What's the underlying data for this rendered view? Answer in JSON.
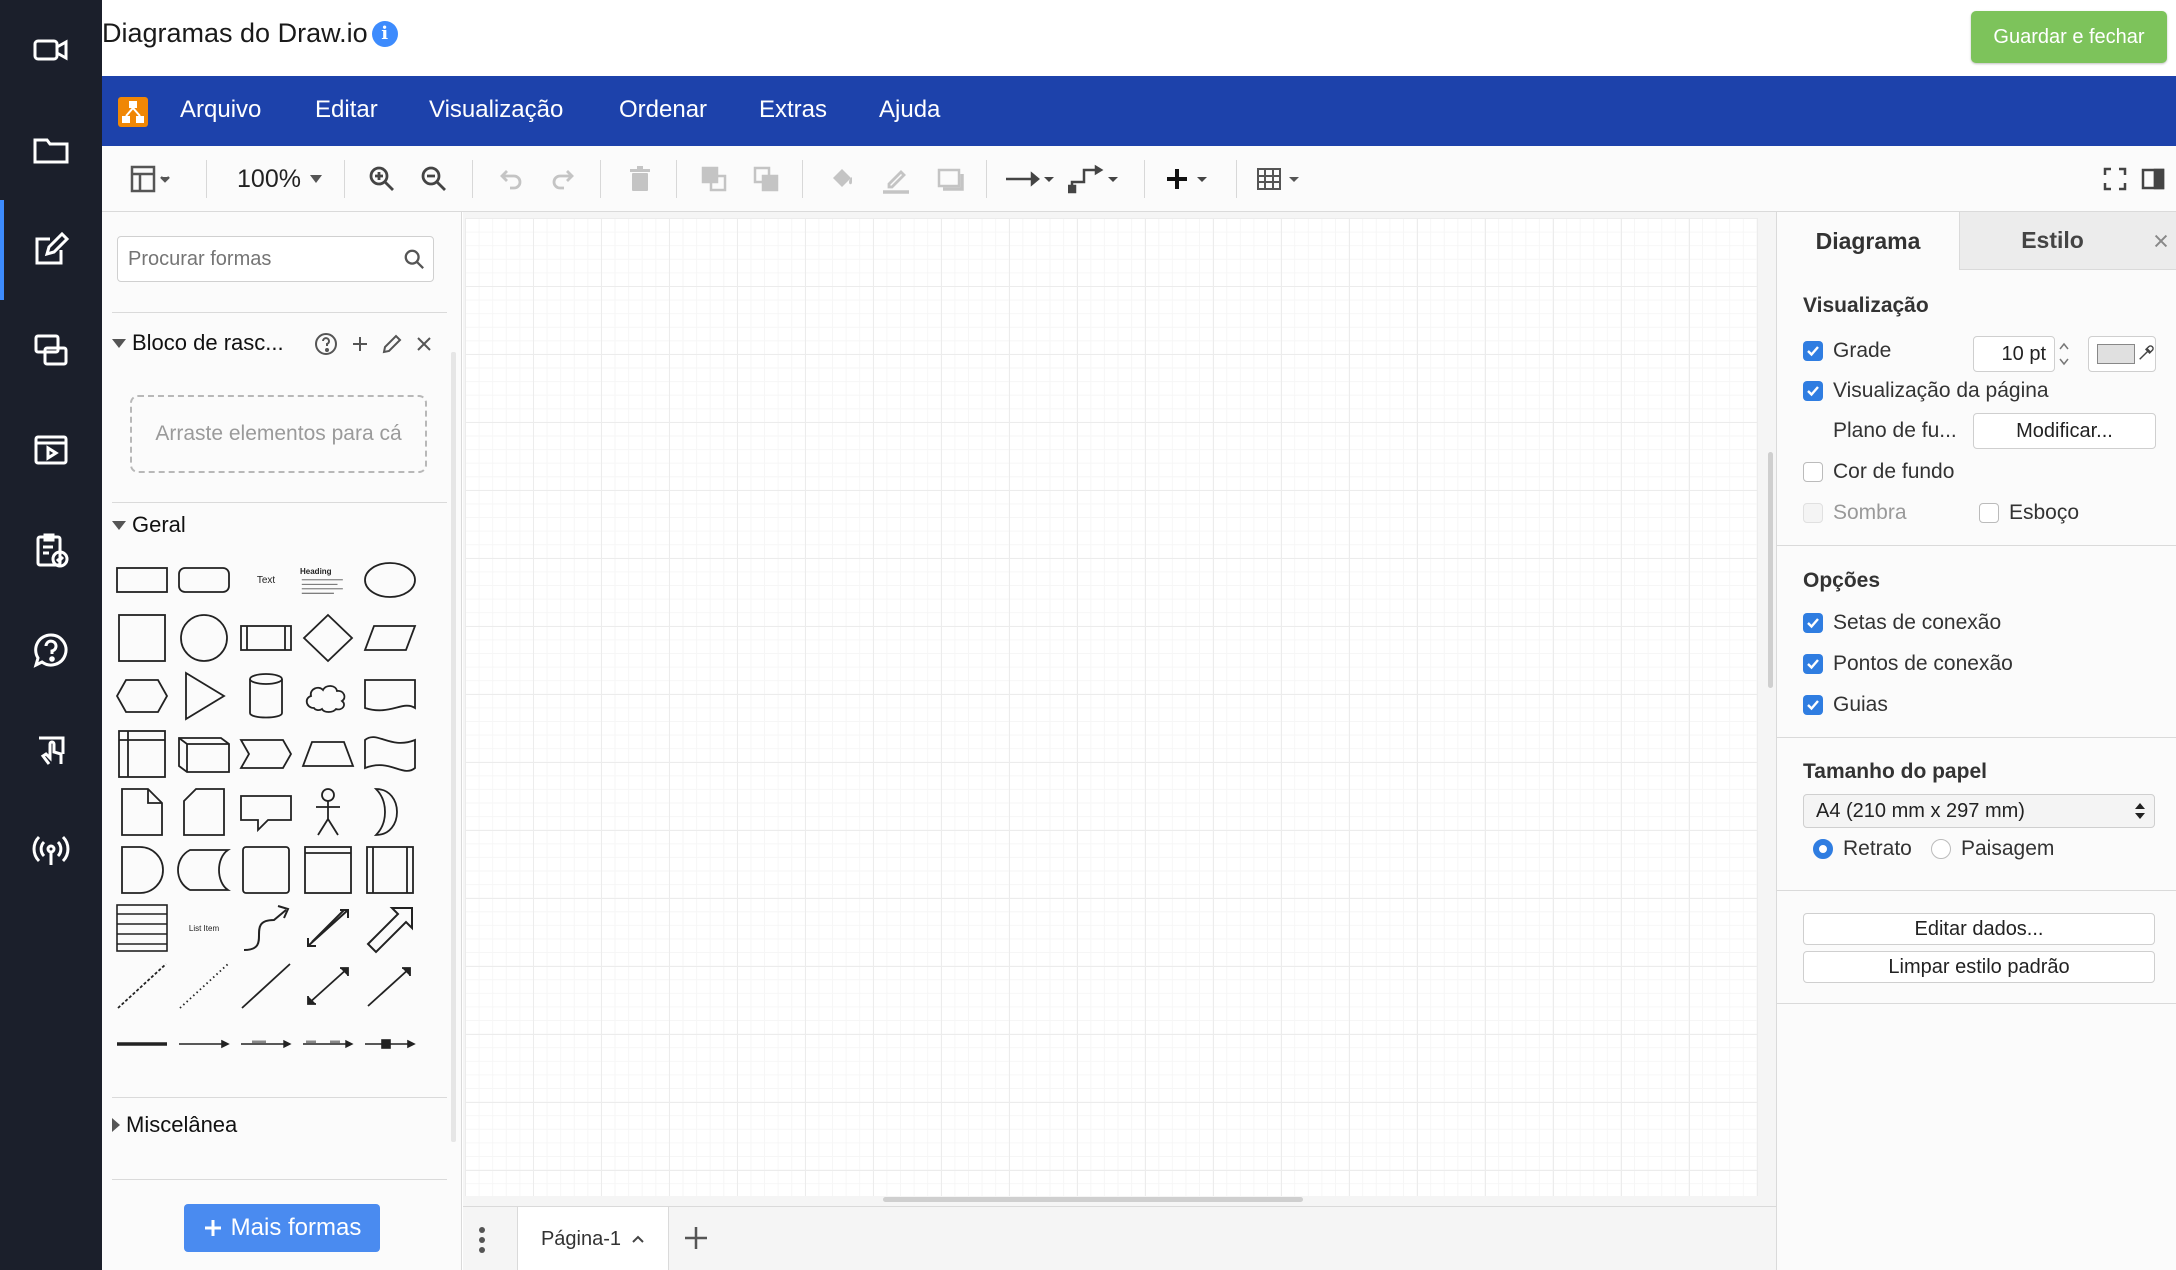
{
  "rail": {
    "items": [
      "video-icon",
      "folder-icon",
      "edit-icon",
      "devices-icon",
      "media-icon",
      "clipboard-check-icon",
      "help-chat-icon",
      "touch-icon",
      "broadcast-icon"
    ],
    "accent": "#3d8bfd"
  },
  "header": {
    "title": "Diagramas do Draw.io",
    "info_glyph": "i",
    "save_label": "Guardar e fechar"
  },
  "menu": {
    "items": [
      "Arquivo",
      "Editar",
      "Visualização",
      "Ordenar",
      "Extras",
      "Ajuda"
    ],
    "bg_color": "#1d42ab"
  },
  "toolbar": {
    "zoom": "100%"
  },
  "shapes_panel": {
    "search_placeholder": "Procurar formas",
    "scratchpad": {
      "title": "Bloco de rasc...",
      "drop_hint": "Arraste elementos para cá"
    },
    "general_title": "Geral",
    "misc_title": "Miscelânea",
    "shape_texts": {
      "text": "Text",
      "heading": "Heading",
      "list_item": "List Item"
    },
    "more_shapes": "Mais formas"
  },
  "pages": {
    "current": "Página-1"
  },
  "format_panel": {
    "tabs": [
      "Diagrama",
      "Estilo"
    ],
    "view_section": "Visualização",
    "grid_label": "Grade",
    "grid_checked": true,
    "grid_size": "10 pt",
    "page_view_label": "Visualização da página",
    "page_view_checked": true,
    "background_label": "Plano de fu...",
    "modify_label": "Modificar...",
    "bg_color_label": "Cor de fundo",
    "bg_color_checked": false,
    "shadow_label": "Sombra",
    "sketch_label": "Esboço",
    "options_section": "Opções",
    "connection_arrows": "Setas de conexão",
    "connection_points": "Pontos de conexão",
    "guides": "Guias",
    "paper_section": "Tamanho do papel",
    "paper_size": "A4 (210 mm x 297 mm)",
    "portrait": "Retrato",
    "landscape": "Paisagem",
    "edit_data": "Editar dados...",
    "clear_style": "Limpar estilo padrão"
  },
  "colors": {
    "save_green": "#7dc35b",
    "checkbox_blue": "#2f7de1",
    "more_blue": "#4a8bf0",
    "rail_bg": "#1b1f2b"
  }
}
